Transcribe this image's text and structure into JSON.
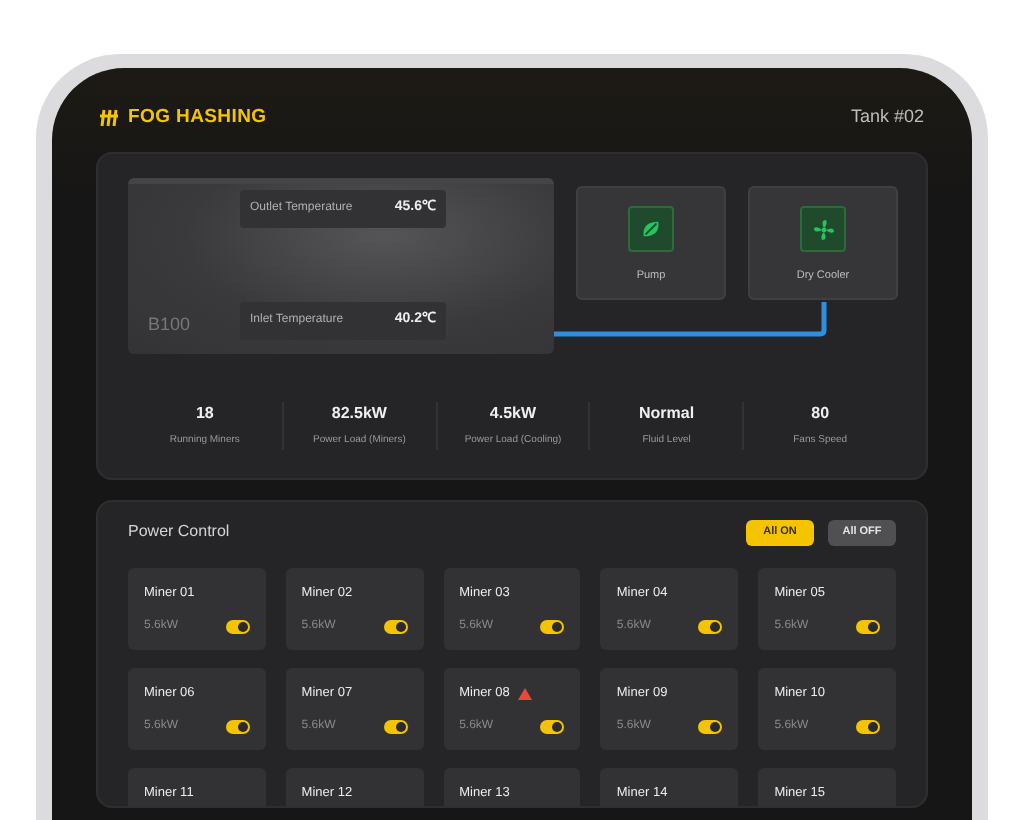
{
  "brand": "FOG HASHING",
  "tank": "Tank #02",
  "diagram": {
    "tank_label": "B100",
    "outlet": {
      "label": "Outlet Temperature",
      "value": "45.6℃"
    },
    "inlet": {
      "label": "Inlet Temperature",
      "value": "40.2℃"
    },
    "units": [
      {
        "name": "Pump",
        "kind": "pump"
      },
      {
        "name": "Dry Cooler",
        "kind": "fan"
      }
    ]
  },
  "stats": [
    {
      "value": "18",
      "label": "Running Miners"
    },
    {
      "value": "82.5kW",
      "label": "Power Load (Miners)"
    },
    {
      "value": "4.5kW",
      "label": "Power Load (Cooling)"
    },
    {
      "value": "Normal",
      "label": "Fluid Level"
    },
    {
      "value": "80",
      "label": "Fans Speed"
    }
  ],
  "power_control": {
    "title": "Power Control",
    "buttons": [
      {
        "label": "All ON",
        "selected": true
      },
      {
        "label": "All OFF",
        "selected": false
      }
    ],
    "miners": [
      {
        "name": "Miner 01",
        "power": "5.6kW",
        "on": true,
        "warning": false
      },
      {
        "name": "Miner 02",
        "power": "5.6kW",
        "on": true,
        "warning": false
      },
      {
        "name": "Miner 03",
        "power": "5.6kW",
        "on": true,
        "warning": false
      },
      {
        "name": "Miner 04",
        "power": "5.6kW",
        "on": true,
        "warning": false
      },
      {
        "name": "Miner 05",
        "power": "5.6kW",
        "on": true,
        "warning": false
      },
      {
        "name": "Miner 06",
        "power": "5.6kW",
        "on": true,
        "warning": false
      },
      {
        "name": "Miner 07",
        "power": "5.6kW",
        "on": true,
        "warning": false
      },
      {
        "name": "Miner 08",
        "power": "5.6kW",
        "on": true,
        "warning": true
      },
      {
        "name": "Miner 09",
        "power": "5.6kW",
        "on": true,
        "warning": false
      },
      {
        "name": "Miner 10",
        "power": "5.6kW",
        "on": true,
        "warning": false
      },
      {
        "name": "Miner 11"
      },
      {
        "name": "Miner 12"
      },
      {
        "name": "Miner 13"
      },
      {
        "name": "Miner 14"
      },
      {
        "name": "Miner 15"
      }
    ]
  }
}
